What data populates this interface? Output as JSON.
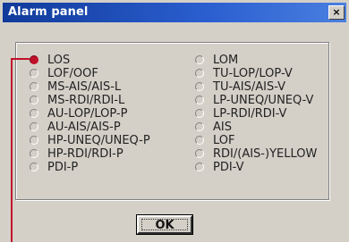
{
  "window": {
    "title": "Alarm panel",
    "close_glyph": "×"
  },
  "options_left": [
    {
      "label": "LOS",
      "checked": true
    },
    {
      "label": "LOF/OOF",
      "checked": false
    },
    {
      "label": "MS-AIS/AIS-L",
      "checked": false
    },
    {
      "label": "MS-RDI/RDI-L",
      "checked": false
    },
    {
      "label": "AU-LOP/LOP-P",
      "checked": false
    },
    {
      "label": "AU-AIS/AIS-P",
      "checked": false
    },
    {
      "label": "HP-UNEQ/UNEQ-P",
      "checked": false
    },
    {
      "label": "HP-RDI/RDI-P",
      "checked": false
    },
    {
      "label": "PDI-P",
      "checked": false
    }
  ],
  "options_right": [
    {
      "label": "LOM",
      "checked": false
    },
    {
      "label": "TU-LOP/LOP-V",
      "checked": false
    },
    {
      "label": "TU-AIS/AIS-V",
      "checked": false
    },
    {
      "label": "LP-UNEQ/UNEQ-V",
      "checked": false
    },
    {
      "label": "LP-RDI/RDI-V",
      "checked": false
    },
    {
      "label": "AIS",
      "checked": false
    },
    {
      "label": "LOF",
      "checked": false
    },
    {
      "label": "RDI/(AIS-)YELLOW",
      "checked": false
    },
    {
      "label": "PDI-V",
      "checked": false
    }
  ],
  "ok_label": "OK",
  "colors": {
    "title_bar": "#103a9a",
    "selected": "#c0102a",
    "face": "#d4d0c8"
  }
}
